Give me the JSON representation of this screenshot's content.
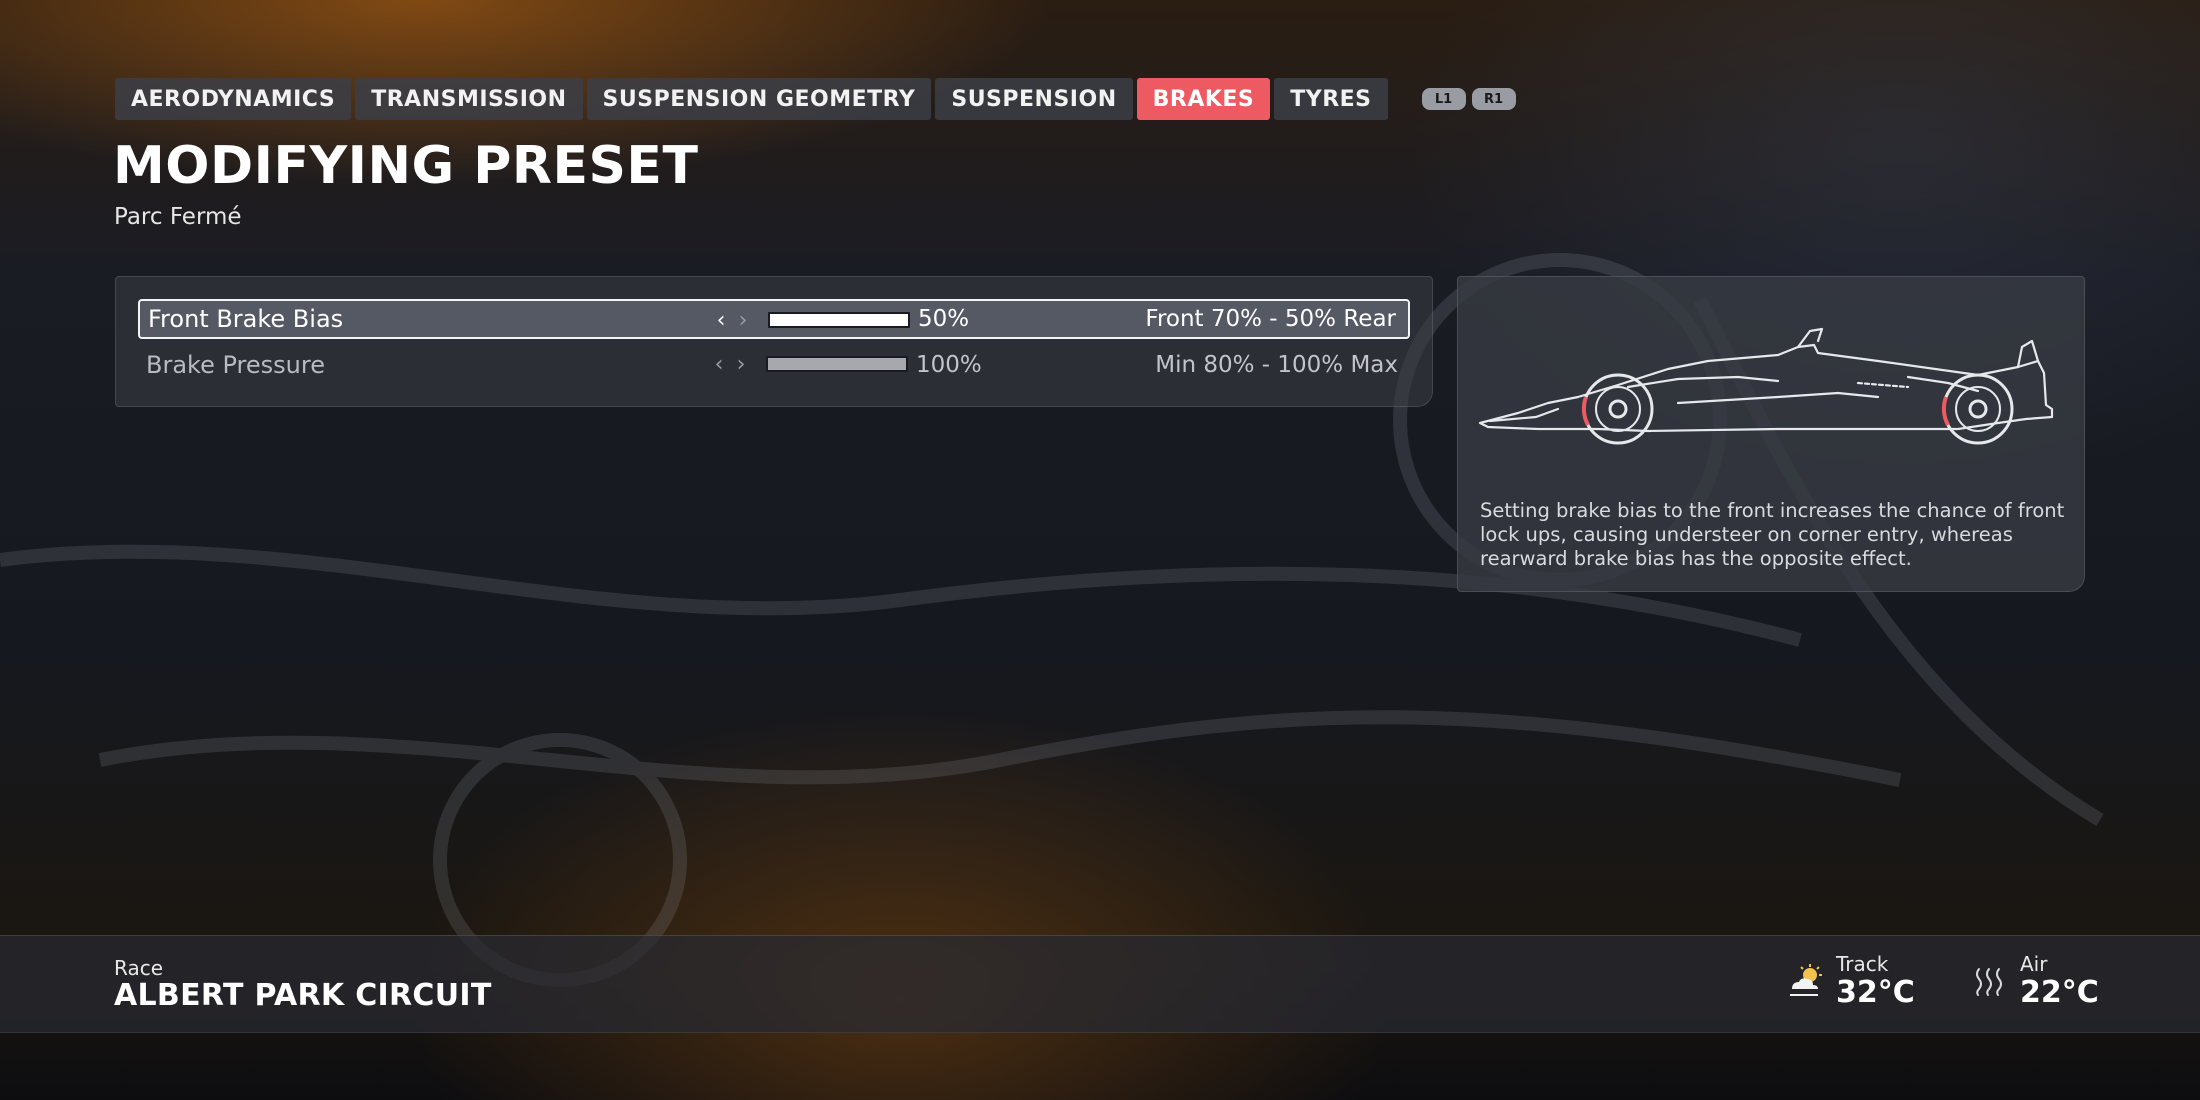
{
  "tabs": [
    {
      "label": "AERODYNAMICS",
      "active": false
    },
    {
      "label": "TRANSMISSION",
      "active": false
    },
    {
      "label": "SUSPENSION GEOMETRY",
      "active": false
    },
    {
      "label": "SUSPENSION",
      "active": false
    },
    {
      "label": "BRAKES",
      "active": true
    },
    {
      "label": "TYRES",
      "active": false
    }
  ],
  "tab_hints": {
    "left": "L1",
    "right": "R1"
  },
  "header": {
    "title": "MODIFYING PRESET",
    "subtitle": "Parc Fermé"
  },
  "settings": [
    {
      "label": "Front Brake Bias",
      "value": "50%",
      "fill_fraction": 1.0,
      "range": "Front 70% - 50% Rear",
      "selected": true
    },
    {
      "label": "Brake Pressure",
      "value": "100%",
      "fill_fraction": 1.0,
      "range": "Min 80% - 100% Max",
      "selected": false
    }
  ],
  "info": {
    "description": "Setting brake bias to the front increases the chance of front lock ups, causing understeer on corner entry, whereas rearward brake bias has the opposite effect.",
    "image_icon": "f1-car-side-icon"
  },
  "footer": {
    "event_type": "Race",
    "circuit": "ALBERT PARK CIRCUIT",
    "track": {
      "label": "Track",
      "value": "32°C",
      "icon": "partly-sunny-icon"
    },
    "air": {
      "label": "Air",
      "value": "22°C",
      "icon": "heat-waves-icon"
    }
  },
  "colors": {
    "accent": "#ee5a62",
    "panel": "#3c3e46",
    "selected_border": "#f4f4f4"
  }
}
